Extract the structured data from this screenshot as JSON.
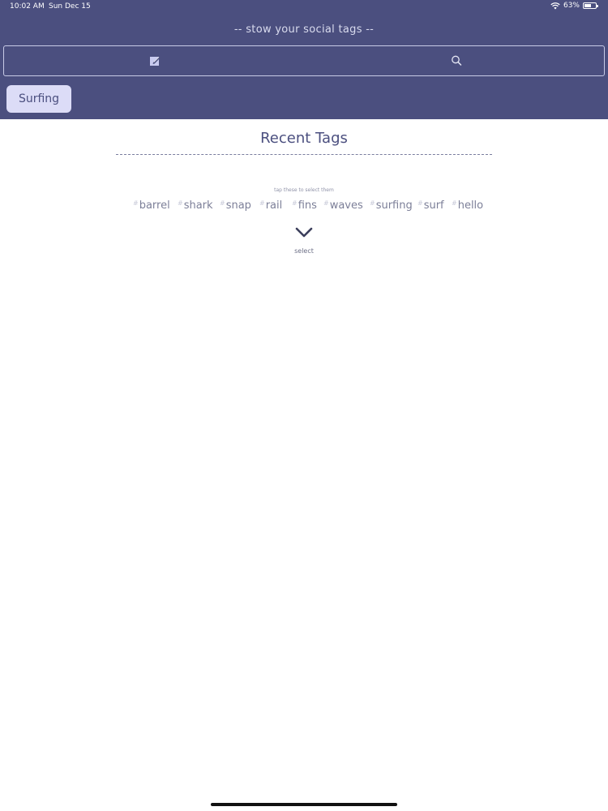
{
  "status_bar": {
    "time": "10:02 AM",
    "date": "Sun Dec 15",
    "battery": "63%",
    "battery_level": 0.63
  },
  "header": {
    "tagline": "-- stow your social tags --",
    "edit_icon": "edit-icon",
    "search_icon": "search-icon",
    "selected_chip": "Surfing"
  },
  "recent": {
    "title": "Recent Tags",
    "hint": "tap these to select them",
    "hash_symbol": "#",
    "tags": [
      "barrel",
      "shark",
      "snap",
      "rail",
      "fins",
      "waves",
      "surfing",
      "surf",
      "hello"
    ],
    "select_label": "select",
    "chevron_icon": "chevron-down-icon"
  },
  "colors": {
    "header_bg": "#4b4f7f",
    "chip_bg": "#dcdcf7",
    "accent": "#4b4f7f",
    "tag_text": "#7c7f98"
  }
}
